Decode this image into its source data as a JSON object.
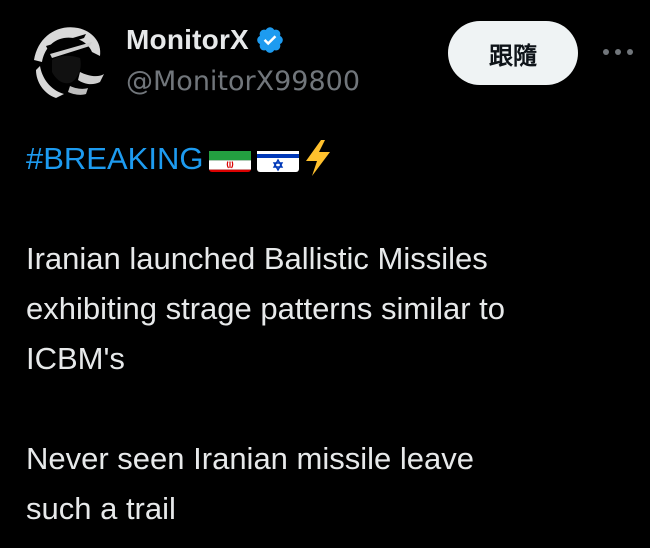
{
  "author": {
    "display_name": "MonitorX",
    "handle": "@MonitorX99800",
    "verified_badge_color": "#1d9bf0",
    "avatar_icon": "hooded-figure-logo"
  },
  "actions": {
    "follow_label": "跟隨",
    "more_icon": "more-icon"
  },
  "tweet": {
    "hashtag": "#BREAKING",
    "emojis": [
      "iran-flag-icon",
      "israel-flag-icon",
      "lightning-icon"
    ],
    "paragraph1": [
      "Iranian launched Ballistic Missiles",
      "exhibiting strage patterns similar to",
      "ICBM's"
    ],
    "paragraph2": [
      "Never seen Iranian missile leave",
      "such a trail"
    ]
  },
  "colors": {
    "background": "#000000",
    "text": "#e7e9ea",
    "secondary": "#71767b",
    "link": "#1d9bf0",
    "button_bg": "#eff3f4"
  }
}
